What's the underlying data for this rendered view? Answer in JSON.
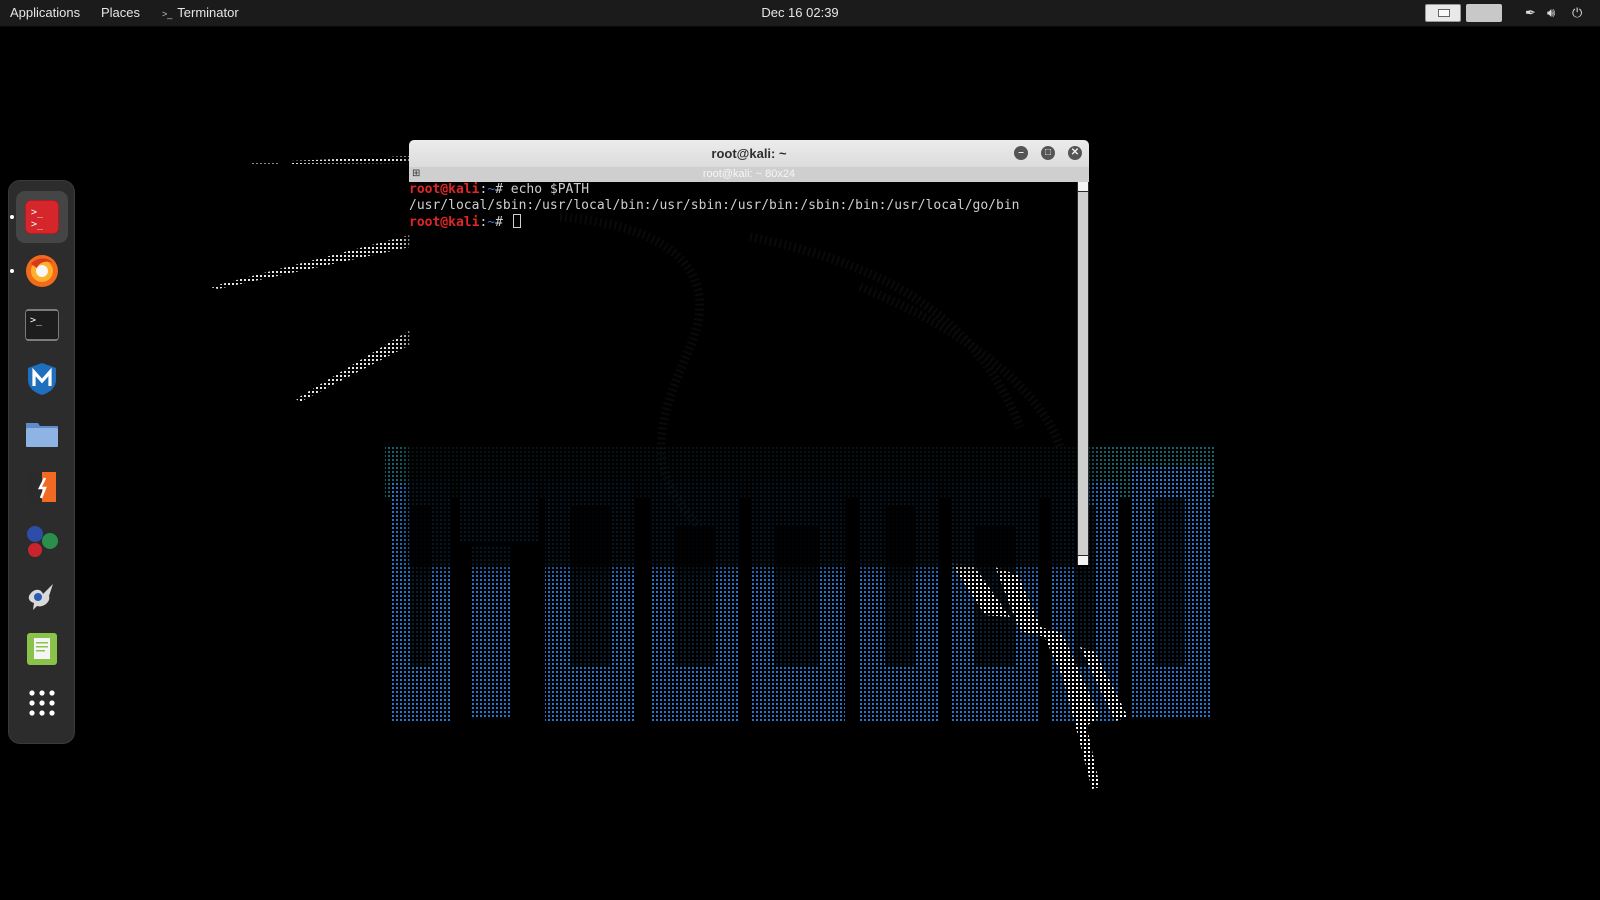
{
  "topbar": {
    "applications": "Applications",
    "places": "Places",
    "app_menu": "Terminator",
    "clock": "Dec 16  02:39"
  },
  "dock": {
    "items": [
      {
        "name": "terminator",
        "running": true,
        "active": true,
        "color": "#d4262b"
      },
      {
        "name": "firefox",
        "running": true,
        "active": false,
        "color": "#f26a1b"
      },
      {
        "name": "terminal",
        "running": false,
        "active": false,
        "color": "#222222"
      },
      {
        "name": "metasploit",
        "running": false,
        "active": false,
        "color": "#1f6fbf"
      },
      {
        "name": "files",
        "running": false,
        "active": false,
        "color": "#7aa7d9"
      },
      {
        "name": "burpsuite",
        "running": false,
        "active": false,
        "color": "#f06a24"
      },
      {
        "name": "maltego",
        "running": false,
        "active": false,
        "color": "#2a8f4a"
      },
      {
        "name": "armitage",
        "running": false,
        "active": false,
        "color": "#cccccc"
      },
      {
        "name": "text-editor",
        "running": false,
        "active": false,
        "color": "#8bc34a"
      },
      {
        "name": "show-apps",
        "running": false,
        "active": false,
        "color": "#ffffff"
      }
    ]
  },
  "terminal": {
    "title": "root@kali: ~",
    "tab_label": "root@kali: ~ 80x24",
    "lines": [
      {
        "user": "root@kali",
        "sep": ":",
        "dir": "~",
        "prompt": "# ",
        "cmd": "echo $PATH"
      },
      {
        "output": "/usr/local/sbin:/usr/local/bin:/usr/sbin:/usr/bin:/sbin:/bin:/usr/local/go/bin"
      },
      {
        "user": "root@kali",
        "sep": ":",
        "dir": "~",
        "prompt": "# ",
        "cmd": ""
      }
    ]
  },
  "colors": {
    "prompt_user": "#e02626",
    "prompt_dir": "#3b6fd6",
    "wallpaper_accent": "#1a6fd8"
  }
}
